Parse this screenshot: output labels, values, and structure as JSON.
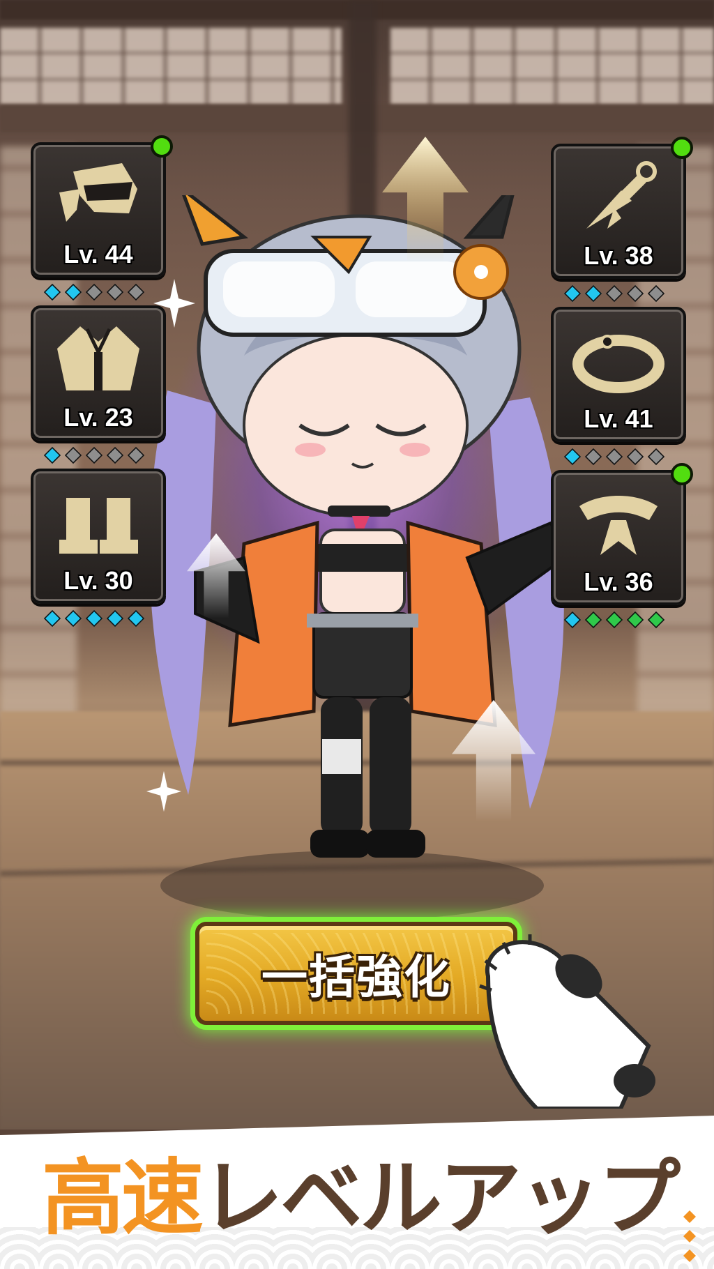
{
  "slots_left": [
    {
      "name": "headgear",
      "level": "Lv. 44",
      "has_alert": true,
      "gems": [
        "cyan",
        "cyan",
        "grey",
        "grey",
        "grey"
      ]
    },
    {
      "name": "armor",
      "level": "Lv. 23",
      "has_alert": false,
      "gems": [
        "cyan",
        "grey",
        "grey",
        "grey",
        "grey"
      ]
    },
    {
      "name": "boots",
      "level": "Lv. 30",
      "has_alert": false,
      "gems": [
        "cyan",
        "cyan",
        "cyan",
        "cyan",
        "cyan"
      ]
    }
  ],
  "slots_right": [
    {
      "name": "kunai",
      "level": "Lv. 38",
      "has_alert": true,
      "gems": [
        "cyan",
        "cyan",
        "grey",
        "grey",
        "grey"
      ]
    },
    {
      "name": "bracelet",
      "level": "Lv. 41",
      "has_alert": false,
      "gems": [
        "cyan",
        "grey",
        "grey",
        "grey",
        "grey"
      ]
    },
    {
      "name": "scarf",
      "level": "Lv. 36",
      "has_alert": true,
      "gems": [
        "cyan",
        "green",
        "green",
        "green",
        "green"
      ]
    }
  ],
  "button": {
    "label": "一括強化"
  },
  "headline": {
    "accent": "高速",
    "rest": "レベルアップ"
  },
  "colors": {
    "gem_cyan": "#22c7f0",
    "gem_grey": "#8e8e8e",
    "gem_green": "#2fc94a",
    "alert": "#52dd10",
    "accent_orange": "#f39322",
    "brown": "#5a3f2c",
    "button_gold": "#e3a924",
    "button_glow": "#7ff03a"
  }
}
